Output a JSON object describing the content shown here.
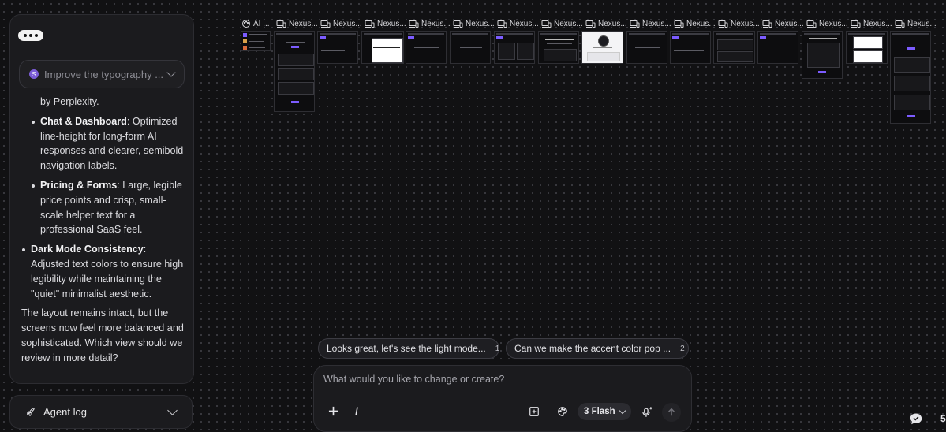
{
  "panel": {
    "prompt_select": {
      "badge": "S",
      "text": "Improve the typography ..."
    },
    "message": {
      "continuation": "by Perplexity.",
      "items": [
        {
          "title": "Chat & Dashboard",
          "text": ": Optimized line-height for long-form AI responses and clearer, semibold navigation labels."
        },
        {
          "title": "Pricing & Forms",
          "text": ": Large, legible price points and crisp, small-scale helper text for a professional SaaS feel."
        }
      ],
      "top_item": {
        "title": "Dark Mode Consistency",
        "text": ": Adjusted text colors to ensure high legibility while maintaining the \"quiet\" minimalist aesthetic."
      },
      "closing": "The layout remains intact, but the screens now feel more balanced and sophisticated. Which view should we review in more detail?"
    },
    "agent_log": {
      "label": "Agent log"
    }
  },
  "tabs": [
    {
      "icon": "palette-icon",
      "label": "AI ..."
    },
    {
      "icon": "devices-icon",
      "label": "Nexus..."
    },
    {
      "icon": "devices-icon",
      "label": "Nexus..."
    },
    {
      "icon": "devices-icon",
      "label": "Nexus..."
    },
    {
      "icon": "devices-icon",
      "label": "Nexus..."
    },
    {
      "icon": "devices-icon",
      "label": "Nexus..."
    },
    {
      "icon": "devices-icon",
      "label": "Nexus..."
    },
    {
      "icon": "devices-icon",
      "label": "Nexus..."
    },
    {
      "icon": "devices-icon",
      "label": "Nexus..."
    },
    {
      "icon": "devices-icon",
      "label": "Nexus..."
    },
    {
      "icon": "devices-icon",
      "label": "Nexus..."
    },
    {
      "icon": "devices-icon",
      "label": "Nexus..."
    },
    {
      "icon": "devices-icon",
      "label": "Nexus..."
    },
    {
      "icon": "devices-icon",
      "label": "Nexus..."
    },
    {
      "icon": "devices-icon",
      "label": "Nexus..."
    },
    {
      "icon": "devices-icon",
      "label": "Nexus..."
    }
  ],
  "suggestions": [
    {
      "label": "Looks great, let's see the light mode...",
      "num": "1"
    },
    {
      "label": "Can we make the accent color pop ...",
      "num": "2"
    }
  ],
  "chat": {
    "placeholder": "What would you like to change or create?",
    "slash": "/",
    "model": "3 Flash"
  },
  "bottom_right": {
    "count": "5"
  },
  "colors": {
    "accent": "#7c5cff",
    "background": "#111113",
    "panel": "#1b1b1e"
  }
}
